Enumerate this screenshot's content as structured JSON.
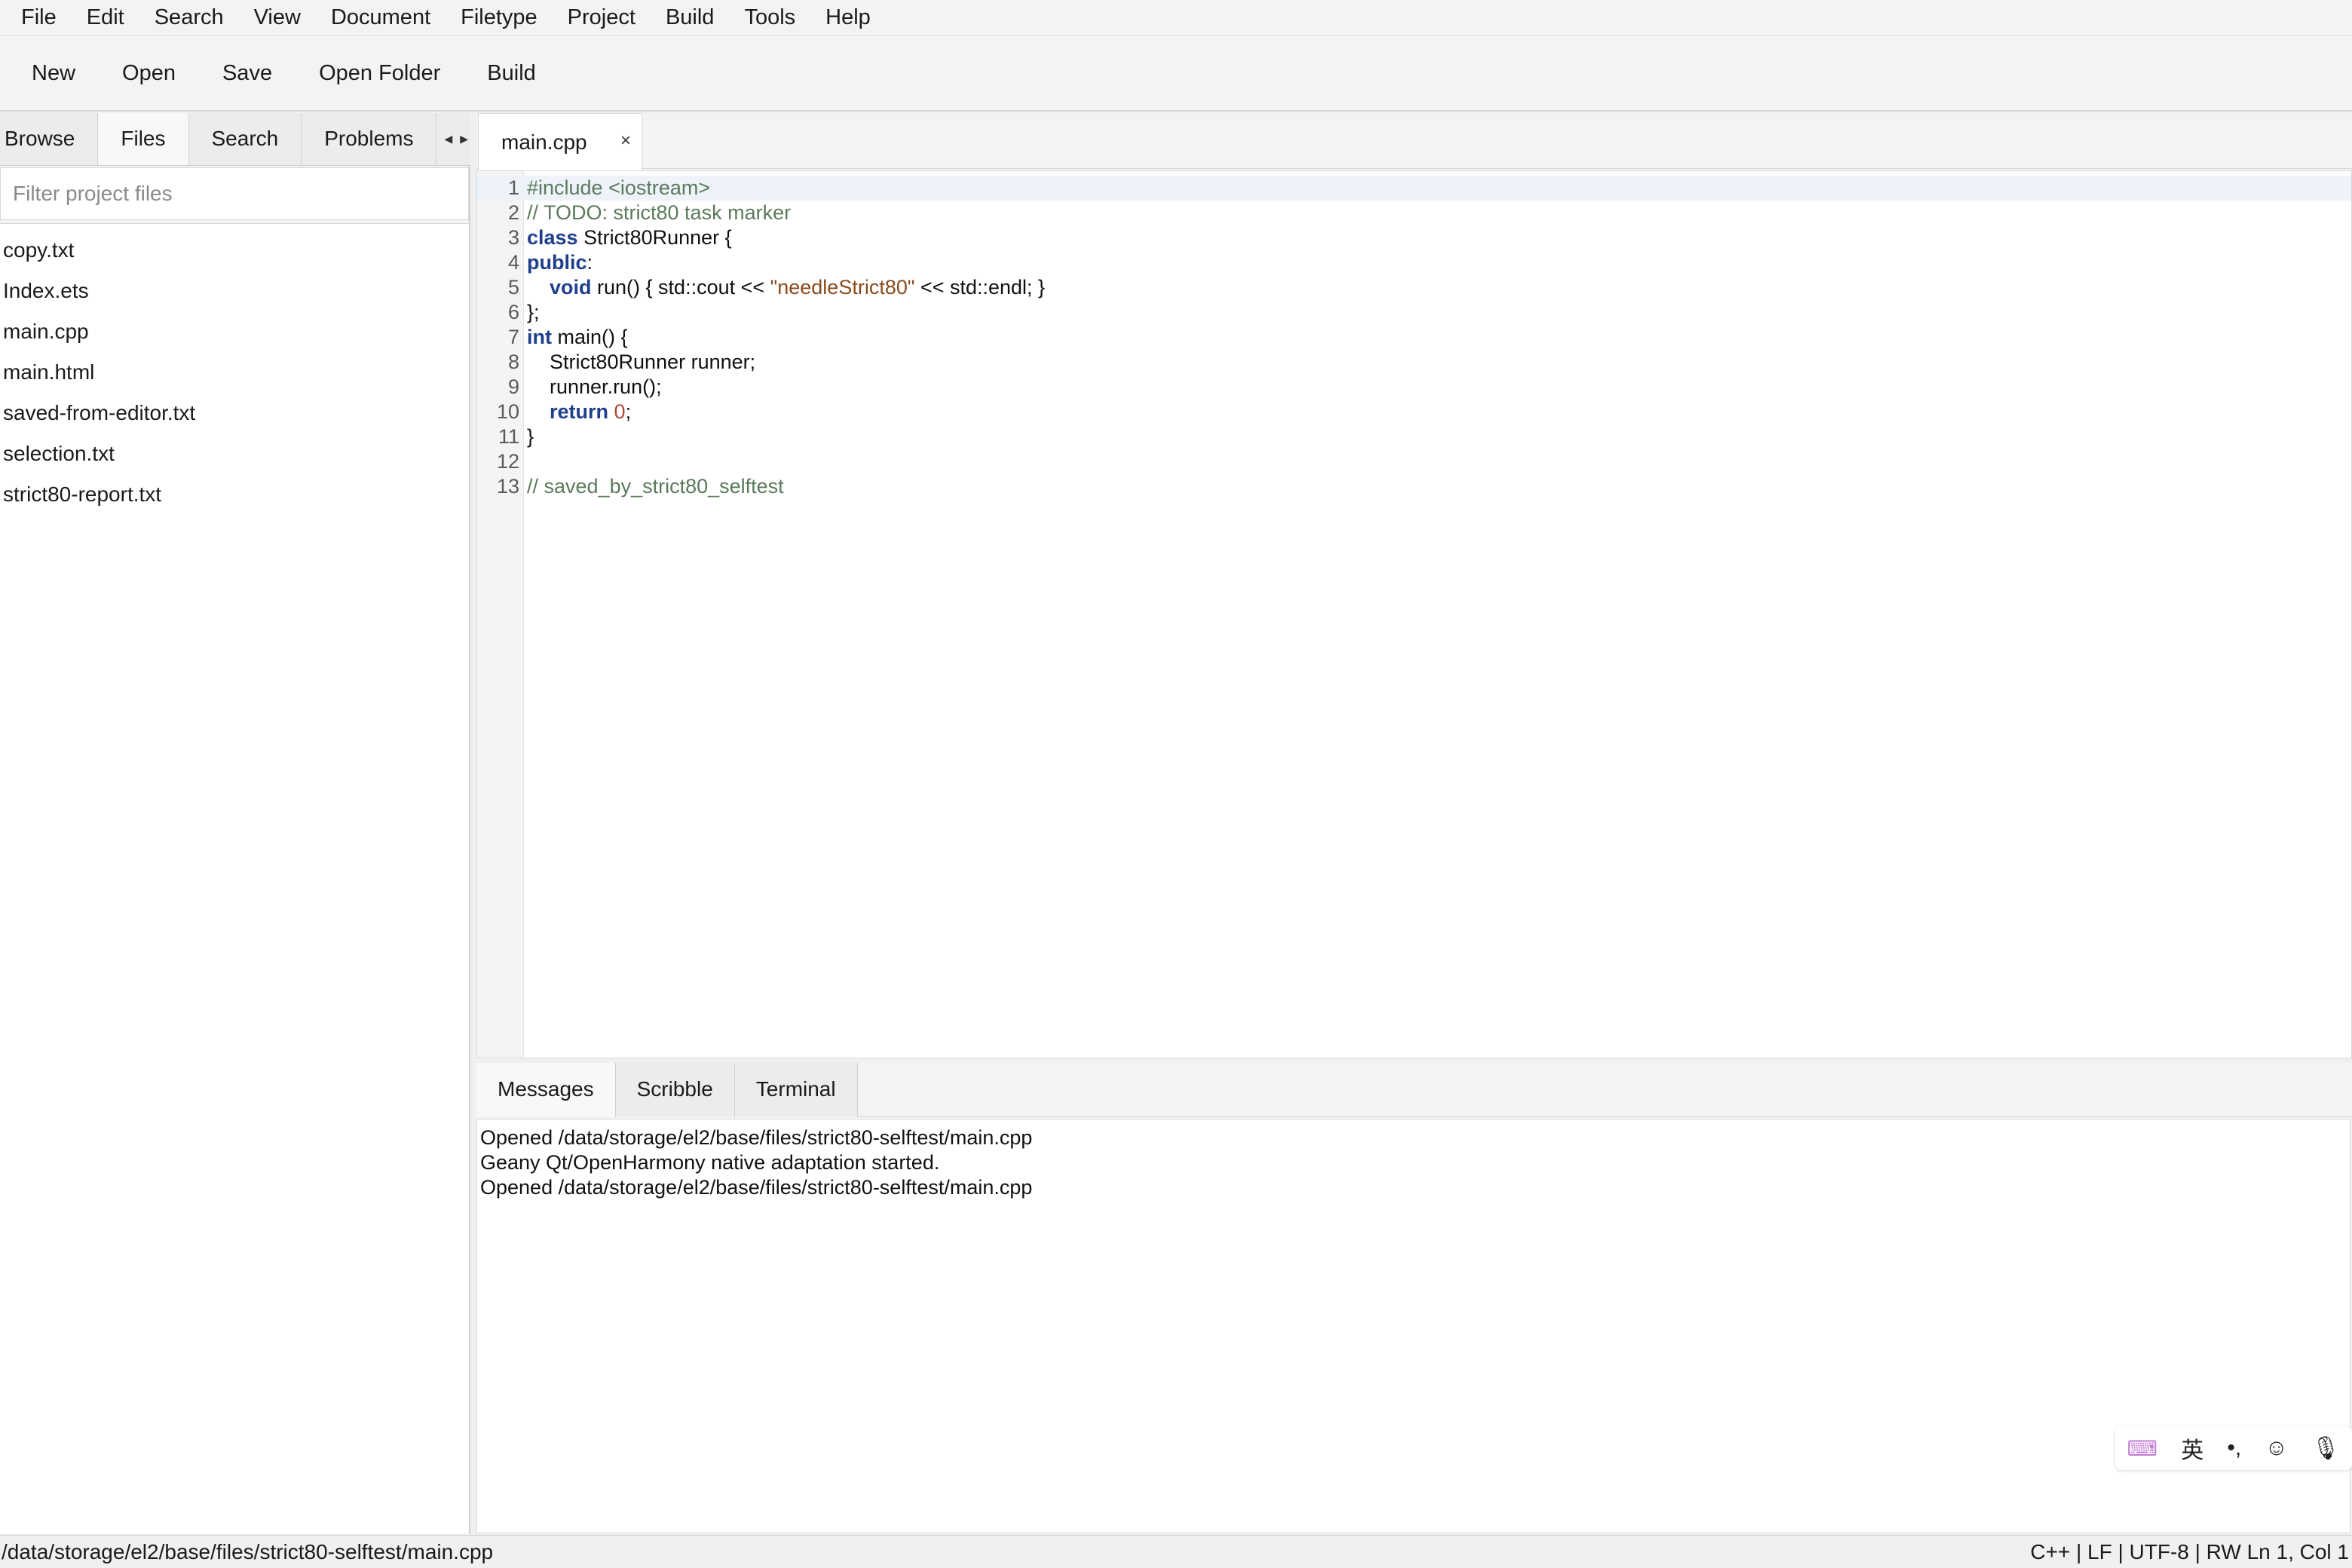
{
  "menu": [
    "File",
    "Edit",
    "Search",
    "View",
    "Document",
    "Filetype",
    "Project",
    "Build",
    "Tools",
    "Help"
  ],
  "toolbar": {
    "new_label": "New",
    "open_label": "Open",
    "save_label": "Save",
    "open_folder_label": "Open Folder",
    "build_label": "Build"
  },
  "sidebar": {
    "tabs": [
      "Browse",
      "Files",
      "Search",
      "Problems"
    ],
    "active_tab": "Files",
    "filter_placeholder": "Filter project files",
    "files": [
      "copy.txt",
      "Index.ets",
      "main.cpp",
      "main.html",
      "saved-from-editor.txt",
      "selection.txt",
      "strict80-report.txt"
    ]
  },
  "editor": {
    "tab_label": "main.cpp",
    "close_glyph": "×",
    "current_line": 1,
    "lines": [
      "#include <iostream>",
      "// TODO: strict80 task marker",
      "class Strict80Runner {",
      "public:",
      "    void run() { std::cout << \"needleStrict80\" << std::endl; }",
      "};",
      "int main() {",
      "    Strict80Runner runner;",
      "    runner.run();",
      "    return 0;",
      "}",
      "",
      "// saved_by_strict80_selftest"
    ]
  },
  "messages": {
    "tabs": [
      "Messages",
      "Scribble",
      "Terminal"
    ],
    "active_tab": "Messages",
    "lines": [
      "Opened /data/storage/el2/base/files/strict80-selftest/main.cpp",
      "Geany Qt/OpenHarmony native adaptation started.",
      "Opened /data/storage/el2/base/files/strict80-selftest/main.cpp"
    ]
  },
  "ime": {
    "icons": [
      "keyboard-icon",
      "language-icon",
      "punctuation-icon",
      "emoji-icon",
      "microphone-icon"
    ],
    "lang_label": "英",
    "punct_label": "•,",
    "emoji_glyph": "☺",
    "mic_glyph": "🎙"
  },
  "status": {
    "path": "/data/storage/el2/base/files/strict80-selftest/main.cpp",
    "info": "C++ | LF | UTF-8 | RW Ln 1, Col 1"
  }
}
